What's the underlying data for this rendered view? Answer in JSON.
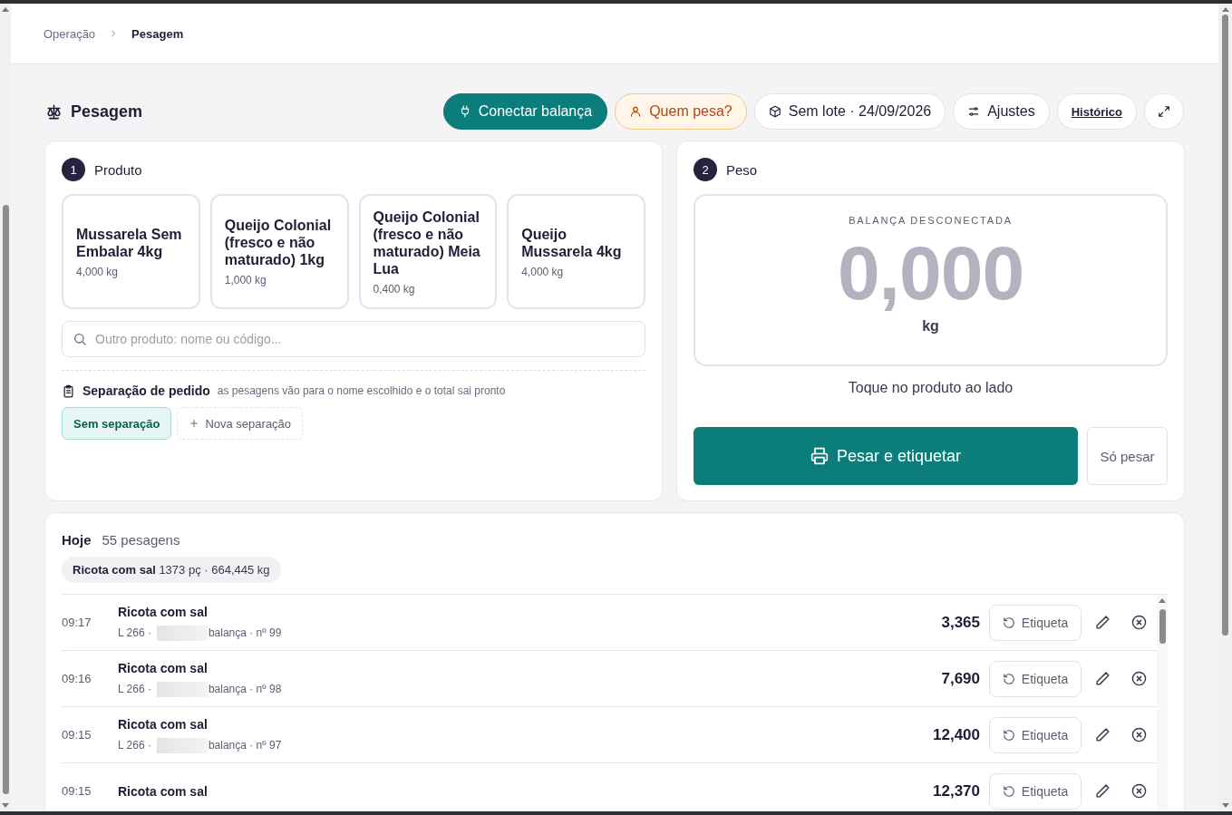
{
  "breadcrumb": [
    {
      "label": "Operação",
      "current": false
    },
    {
      "label": "Pesagem",
      "current": true
    }
  ],
  "page_title": "Pesagem",
  "toolbar": [
    {
      "kind": "primary",
      "label": "Conectar balança"
    },
    {
      "kind": "warning",
      "label": "Quem pesa?"
    },
    {
      "kind": "pill",
      "label": "Sem lote · 24/09/2026"
    },
    {
      "kind": "pill",
      "label": "Ajustes"
    },
    {
      "kind": "link",
      "label": "Histórico"
    },
    {
      "kind": "icon"
    }
  ],
  "product_section": {
    "step": "1",
    "title": "Produto",
    "products": [
      {
        "name": "Mussarela Sem Embalar 4kg",
        "weight": "4,000 kg"
      },
      {
        "name": "Queijo Colonial (fresco e não maturado) 1kg",
        "weight": "1,000 kg"
      },
      {
        "name": "Queijo Colonial (fresco e não maturado) Meia Lua",
        "weight": "0,400 kg"
      },
      {
        "name": "Queijo Mussarela 4kg",
        "weight": "4,000 kg"
      }
    ],
    "search": {
      "placeholder": "Outro produto: nome ou código..."
    },
    "separation": {
      "title": "Separação de pedido",
      "hint": "as pesagens vão para o nome escolhido e o total sai pronto",
      "options": [
        {
          "kind": "option",
          "label": "Sem separação",
          "selected": true
        },
        {
          "kind": "add",
          "label": "Nova separação",
          "selected": false
        }
      ]
    }
  },
  "weight_section": {
    "step": "2",
    "title": "Peso",
    "status": "BALANÇA DESCONECTADA",
    "connected": false,
    "reading": "0,000",
    "unit": "kg",
    "hint": "Toque no produto ao lado",
    "buttons": [
      {
        "kind": "primary",
        "label": "Pesar e etiquetar"
      },
      {
        "kind": "secondary",
        "label": "Só pesar"
      }
    ]
  },
  "history": {
    "title": "Hoje",
    "count": "55 pesagens",
    "summary": "**Ricota com sal** 1373 pç · 664,445 kg",
    "rows": [
      {
        "time": "09:17",
        "product": "Ricota com sal",
        "lot": "L 266 ·",
        "meta": "balança · nº 99",
        "weight": "3,365",
        "action": "Etiqueta"
      },
      {
        "time": "09:16",
        "product": "Ricota com sal",
        "lot": "L 266 ·",
        "meta": "balança · nº 98",
        "weight": "7,690",
        "action": "Etiqueta"
      },
      {
        "time": "09:15",
        "product": "Ricota com sal",
        "lot": "L 266 ·",
        "meta": "balança · nº 97",
        "weight": "12,400",
        "action": "Etiqueta"
      },
      {
        "time": "09:15",
        "product": "Ricota com sal",
        "weight": "12,370",
        "action": "Etiqueta"
      }
    ]
  }
}
